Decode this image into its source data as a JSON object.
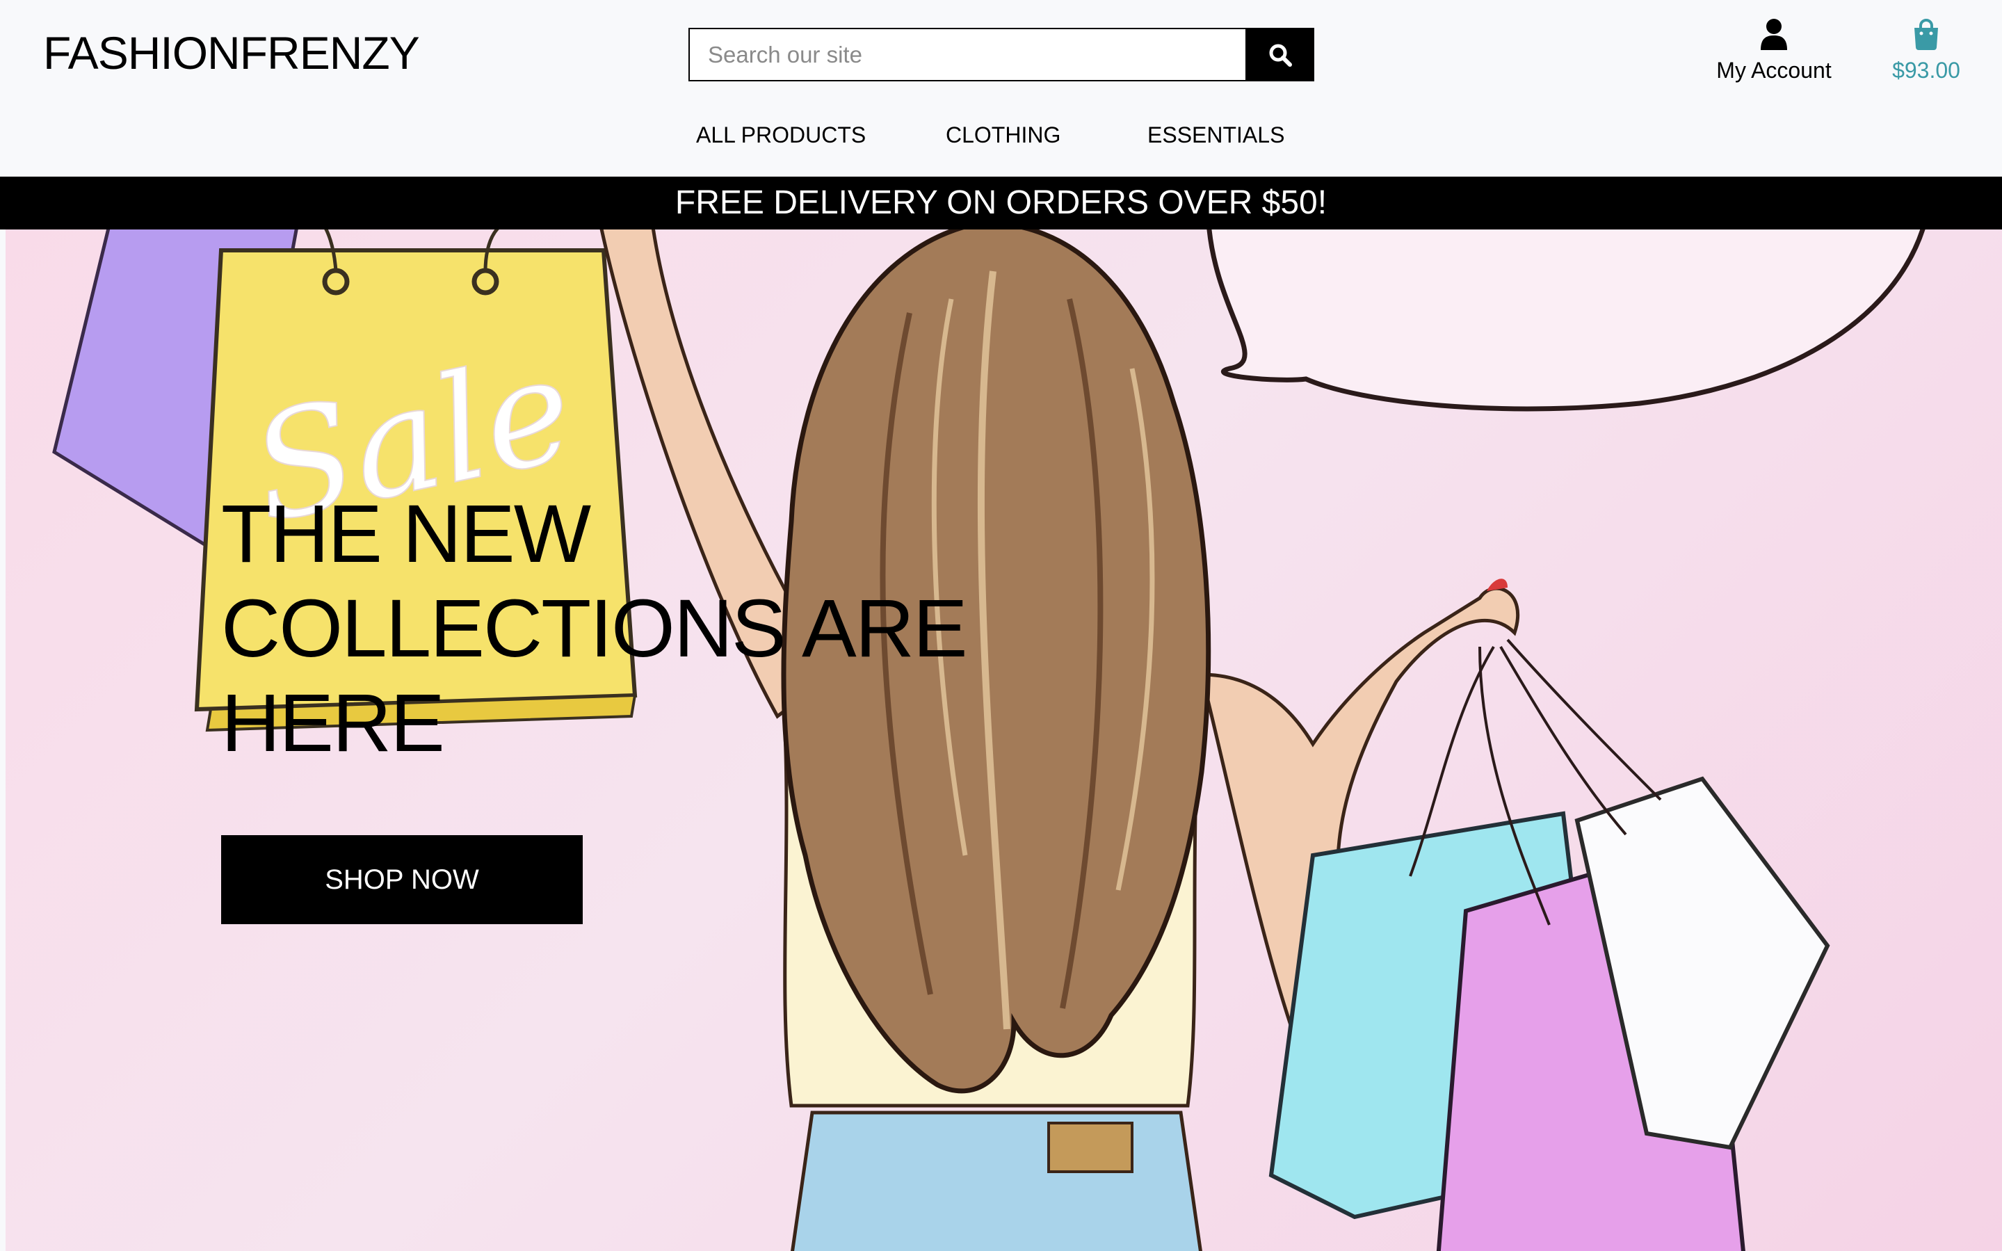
{
  "header": {
    "logo": "FASHIONFRENZY",
    "search": {
      "placeholder": "Search our site",
      "value": ""
    },
    "account_label": "My Account",
    "cart_total": "$93.00",
    "accent_color": "#3a9aa6"
  },
  "nav": {
    "items": [
      {
        "label": "ALL PRODUCTS"
      },
      {
        "label": "CLOTHING"
      },
      {
        "label": "ESSENTIALS"
      }
    ]
  },
  "banner": {
    "text": "FREE DELIVERY ON ORDERS OVER $50!"
  },
  "hero": {
    "title_lines": [
      "THE NEW",
      "COLLECTIONS ARE",
      "HERE"
    ],
    "cta_label": "SHOP NOW",
    "illustration": "woman-with-shopping-bags",
    "bag_text": "Sale",
    "background_color": "#f8dbe9"
  },
  "icons": {
    "search": "search-icon",
    "account": "user-icon",
    "cart": "shopping-bag-icon"
  }
}
